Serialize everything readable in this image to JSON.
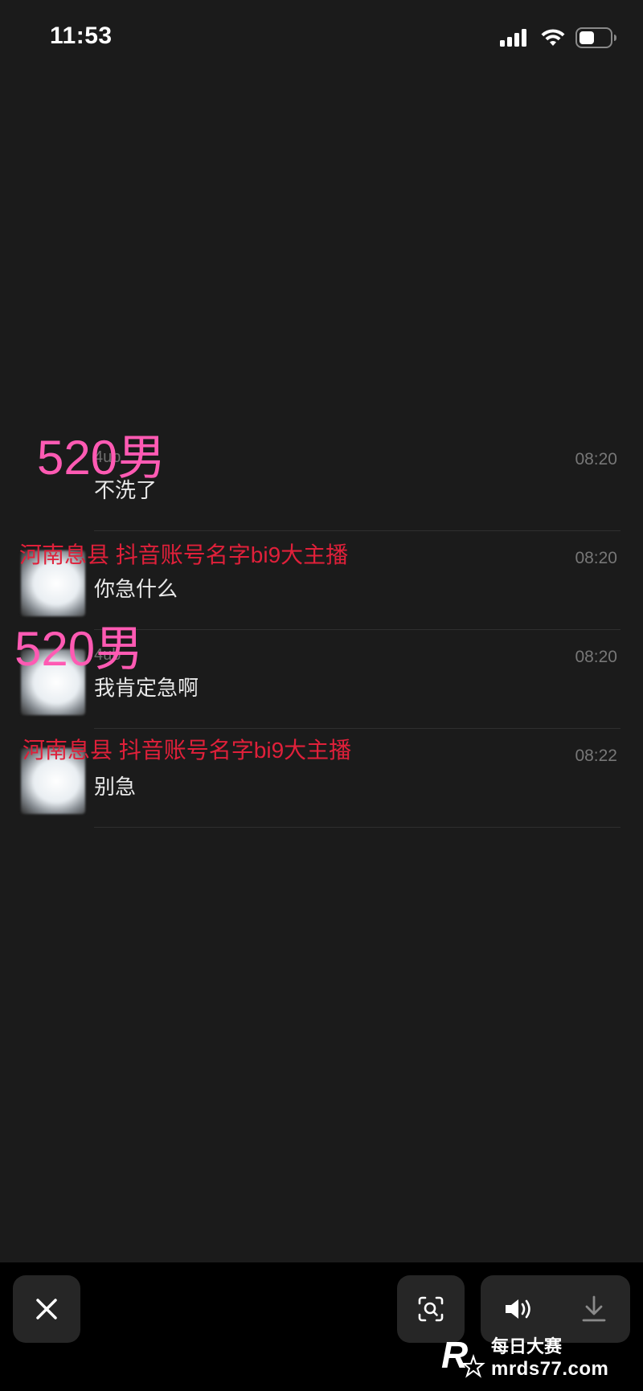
{
  "status_bar": {
    "time": "11:53"
  },
  "messages": [
    {
      "sender": "4ub",
      "text": "不洗了",
      "time": "08:20"
    },
    {
      "sender": "",
      "text": "你急什么",
      "time": "08:20"
    },
    {
      "sender": "4ub",
      "text": "我肯定急啊",
      "time": "08:20"
    },
    {
      "sender": "",
      "text": "别急",
      "time": "08:22"
    }
  ],
  "overlays": {
    "label_1": "520男",
    "label_2": "河南息县 抖音账号名字bi9大主播",
    "label_3": "520男",
    "label_4": "河南息县 抖音账号名字bi9大主播"
  },
  "watermark": {
    "title": "每日大赛",
    "url": "mrds77.com",
    "logo_letter": "R"
  },
  "icons": {
    "signal": "cellular-signal-icon",
    "wifi": "wifi-icon",
    "battery": "battery-icon",
    "close": "close-icon",
    "lens": "visual-lookup-icon",
    "speaker": "speaker-icon",
    "download": "download-icon"
  },
  "colors": {
    "overlay_pink": "#ff5ab3",
    "overlay_red": "#e0203a",
    "background": "#1b1b1b"
  }
}
